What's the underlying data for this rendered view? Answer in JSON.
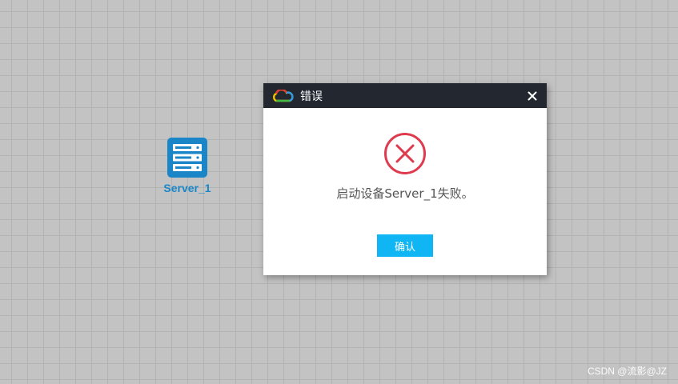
{
  "canvas": {
    "device": {
      "label": "Server_1",
      "icon": "server-icon"
    }
  },
  "dialog": {
    "title": "错误",
    "logo_icon": "cloud-logo-icon",
    "close_icon": "close-icon",
    "status_icon": "error-circle-x-icon",
    "message": "启动设备Server_1失败。",
    "ok_label": "确认"
  },
  "watermark": "CSDN @流影@JZ",
  "colors": {
    "titlebar": "#232830",
    "error": "#e03a4e",
    "button": "#10b5f4",
    "device": "#1a86c8",
    "canvas": "#c3c3c3"
  }
}
